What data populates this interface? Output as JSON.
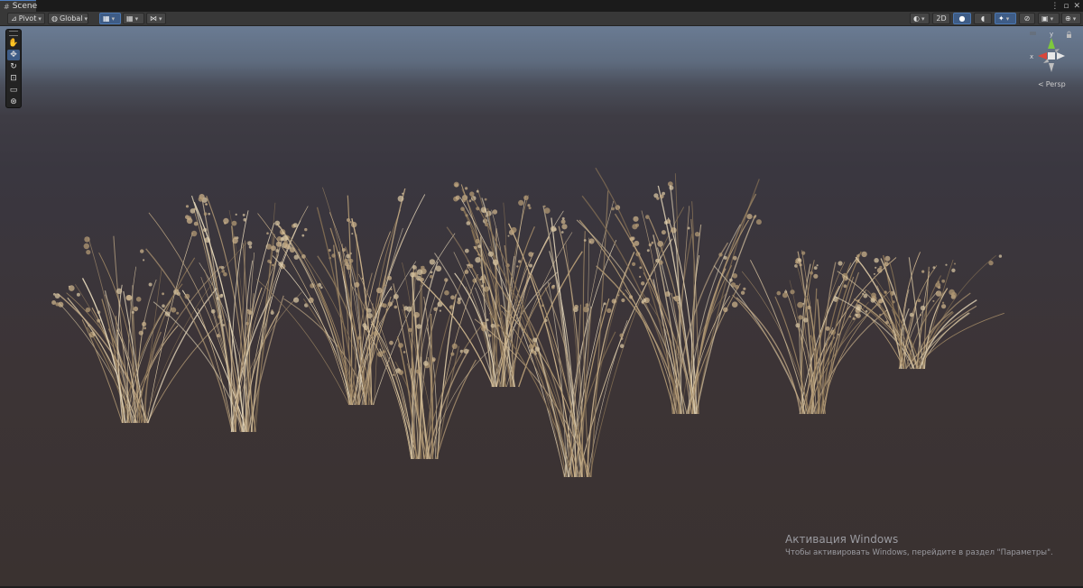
{
  "window": {
    "tab_label": "Scene",
    "tab_icon": "hash-icon"
  },
  "toolbar": {
    "pivot_label": "Pivot",
    "global_label": "Global",
    "mode_2d_label": "2D"
  },
  "gizmo": {
    "y_label": "y",
    "x_label": "x",
    "projection_label": "Persp"
  },
  "watermark": {
    "title": "Активация Windows",
    "subtitle": "Чтобы активировать Windows, перейдите в раздел \"Параметры\"."
  },
  "colors": {
    "accent": "#3e5c86",
    "axis_x": "#d9463b",
    "axis_y": "#7ec83c",
    "grass": "#b09a78"
  }
}
